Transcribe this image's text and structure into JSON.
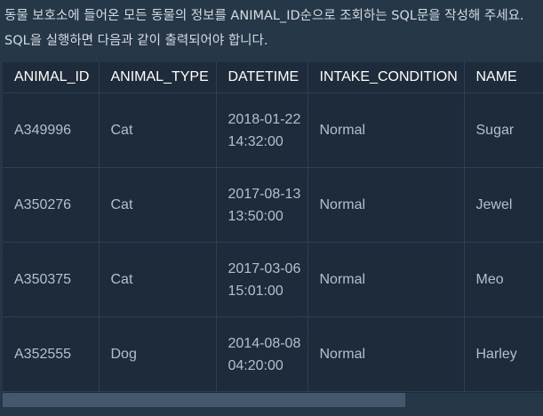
{
  "description": "동물 보호소에 들어온 모든 동물의 정보를 ANIMAL_ID순으로 조회하는 SQL문을 작성해 주세요. SQL을 실행하면 다음과 같이 출력되어야 합니다.",
  "table": {
    "headers": [
      "ANIMAL_ID",
      "ANIMAL_TYPE",
      "DATETIME",
      "INTAKE_CONDITION",
      "NAME"
    ],
    "rows": [
      {
        "animal_id": "A349996",
        "animal_type": "Cat",
        "datetime": "2018-01-22 14:32:00",
        "intake_condition": "Normal",
        "name": "Sugar"
      },
      {
        "animal_id": "A350276",
        "animal_type": "Cat",
        "datetime": "2017-08-13 13:50:00",
        "intake_condition": "Normal",
        "name": "Jewel"
      },
      {
        "animal_id": "A350375",
        "animal_type": "Cat",
        "datetime": "2017-03-06 15:01:00",
        "intake_condition": "Normal",
        "name": "Meo"
      },
      {
        "animal_id": "A352555",
        "animal_type": "Dog",
        "datetime": "2014-08-08 04:20:00",
        "intake_condition": "Normal",
        "name": "Harley"
      }
    ]
  },
  "colors": {
    "page_background": "#263747",
    "table_background": "#1e2b3a",
    "header_text": "#ffffff",
    "cell_text": "#b2c0cc",
    "scrollbar_thumb": "#44576c"
  }
}
